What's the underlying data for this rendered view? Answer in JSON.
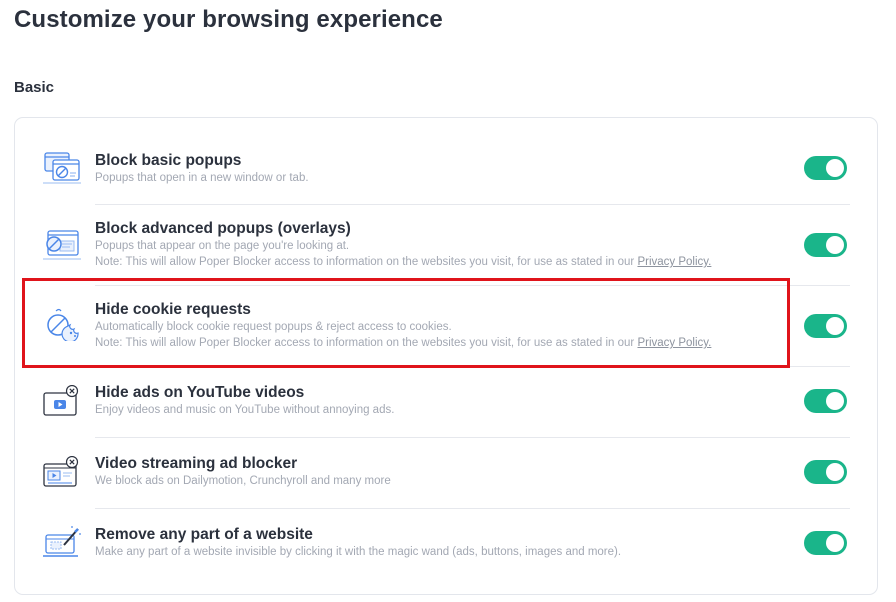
{
  "page": {
    "title": "Customize your browsing experience",
    "section_title": "Basic"
  },
  "settings": [
    {
      "title": "Block basic popups",
      "description": "Popups that open in a new window or tab.",
      "enabled": true,
      "icon": "popup-windows-icon"
    },
    {
      "title": "Block advanced popups (overlays)",
      "description": "Popups that appear on the page you're looking at.",
      "note": "Note: This will allow Poper Blocker access to information on the websites you visit, for use as stated in our ",
      "note_link": "Privacy Policy.",
      "enabled": true,
      "icon": "overlay-block-icon"
    },
    {
      "title": "Hide cookie requests",
      "description": "Automatically block cookie request popups & reject access to cookies.",
      "note": "Note: This will allow Poper Blocker access to information on the websites you visit, for use as stated in our ",
      "note_link": "Privacy Policy.",
      "enabled": true,
      "icon": "cookie-block-icon"
    },
    {
      "title": "Hide ads on YouTube videos",
      "description": "Enjoy videos and music on YouTube without annoying ads.",
      "enabled": true,
      "icon": "youtube-block-icon"
    },
    {
      "title": "Video streaming ad blocker",
      "description": "We block ads on Dailymotion, Crunchyroll and many more",
      "enabled": true,
      "icon": "video-player-block-icon"
    },
    {
      "title": "Remove any part of a website",
      "description": "Make any part of a website invisible by clicking it with the magic wand (ads, buttons, images and more).",
      "enabled": true,
      "icon": "magic-wand-icon"
    }
  ],
  "colors": {
    "toggle_on": "#1ab58a",
    "highlight": "#e0141b",
    "icon_blue": "#4a86e8"
  }
}
